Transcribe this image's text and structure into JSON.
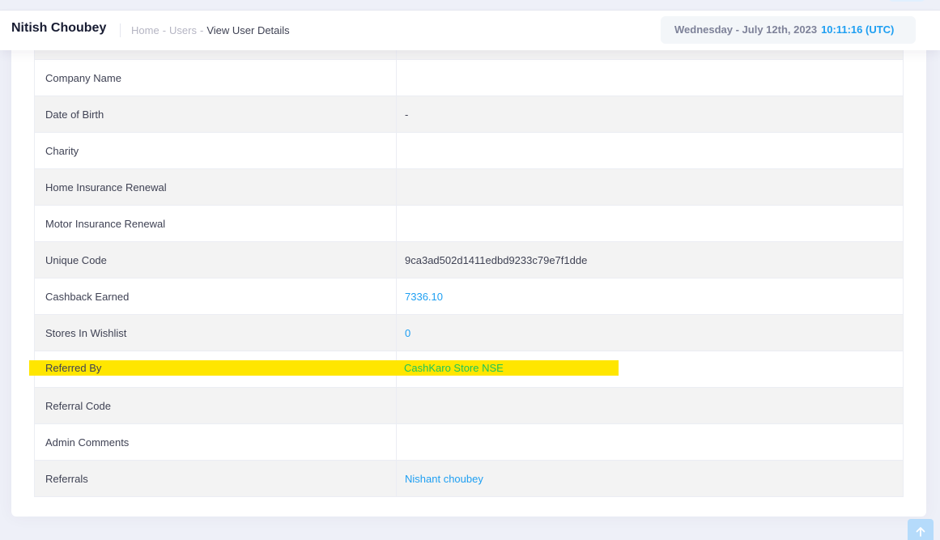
{
  "header": {
    "title": "Nitish Choubey",
    "breadcrumb": {
      "home": "Home",
      "users": "Users",
      "current": "View User Details",
      "separator": "-"
    },
    "date": "Wednesday - July 12th, 2023",
    "time": "10:11:16 (UTC)"
  },
  "details": {
    "rows": [
      {
        "label": "",
        "value": ""
      },
      {
        "label": "Company Name",
        "value": ""
      },
      {
        "label": "Date of Birth",
        "value": "-"
      },
      {
        "label": "Charity",
        "value": ""
      },
      {
        "label": "Home Insurance Renewal",
        "value": ""
      },
      {
        "label": "Motor Insurance Renewal",
        "value": ""
      },
      {
        "label": "Unique Code",
        "value": "9ca3ad502d1411edbd9233c79e7f1dde"
      },
      {
        "label": "Cashback Earned",
        "value": "7336.10"
      },
      {
        "label": "Stores In Wishlist",
        "value": "0"
      },
      {
        "label": "Referred By",
        "value": "CashKaro Store NSE"
      },
      {
        "label": "Referral Code",
        "value": ""
      },
      {
        "label": "Admin Comments",
        "value": ""
      },
      {
        "label": "Referrals",
        "value": "Nishant choubey"
      }
    ]
  },
  "icons": {
    "scroll_top": "arrow-up-icon"
  },
  "colors": {
    "link": "#1e9ff2",
    "highlight": "#ffe600",
    "referred_by_link": "#1bc55a",
    "time": "#1e9ff2"
  }
}
